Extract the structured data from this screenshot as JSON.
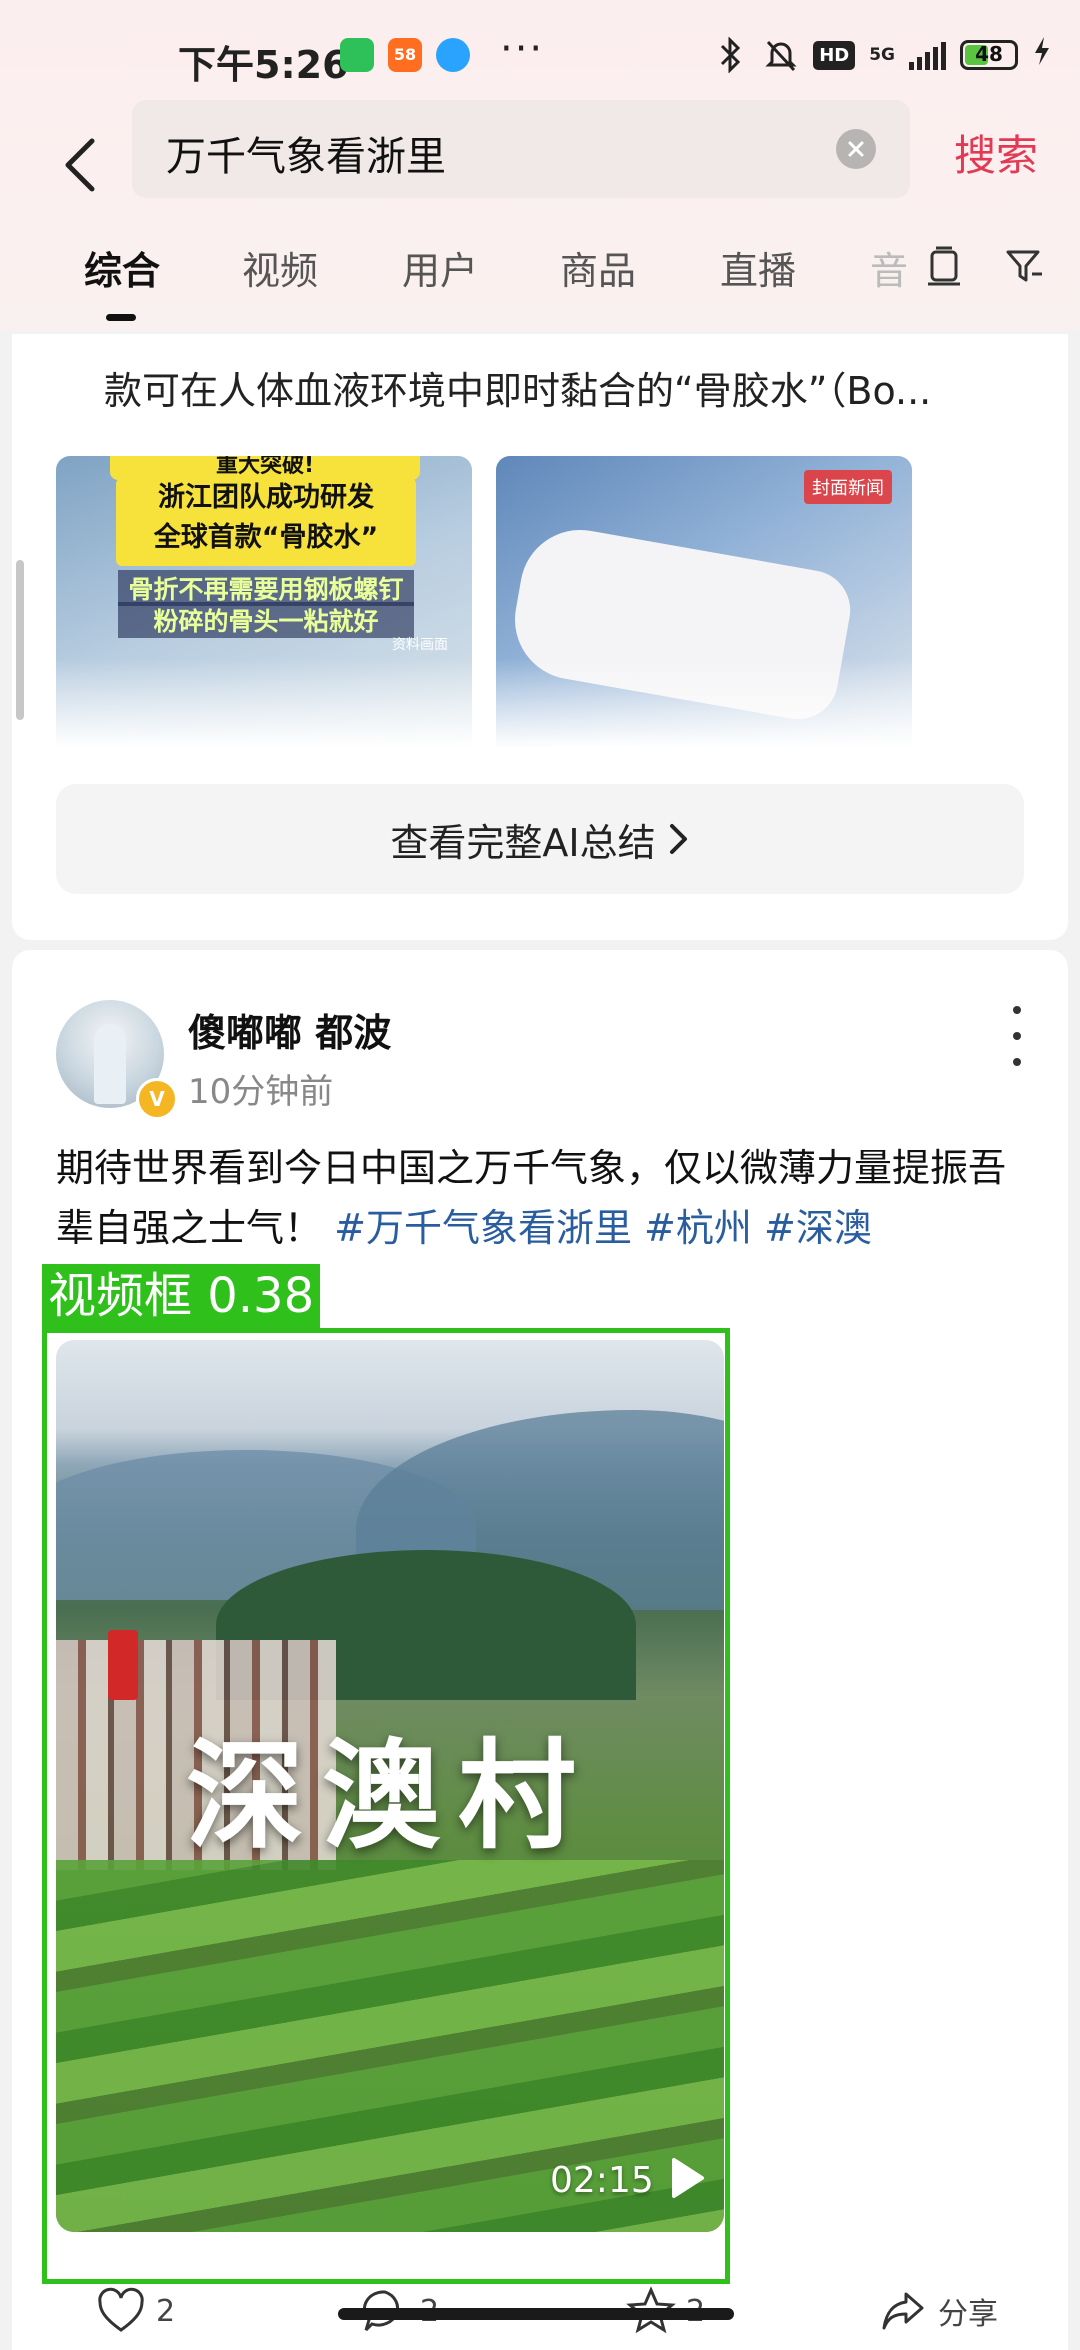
{
  "status_bar": {
    "time": "下午5:26",
    "app2_text": "58",
    "more": "···",
    "hd": "HD",
    "network": "5G",
    "battery": "48",
    "battery_level": 0.48
  },
  "header": {
    "search_query": "万千气象看浙里",
    "search_button": "搜索"
  },
  "tabs": {
    "items": [
      "综合",
      "视频",
      "用户",
      "商品",
      "直播"
    ],
    "partial": "音",
    "active_index": 0
  },
  "ai_summary": {
    "text": "款可在人体血液环境中即时黏合的“骨胶水”（Bo...",
    "thumb1": {
      "line0": "重大突破!",
      "line1": "浙江团队成功研发",
      "line2": "全球首款“骨胶水”",
      "line3": "骨折不再需要用钢板螺钉",
      "line4": "粉碎的骨头一粘就好",
      "small": "资料画面"
    },
    "thumb2": {
      "brand": "封面新闻"
    },
    "view_full_button": "查看完整AI总结"
  },
  "post": {
    "author": "傻嘟嘟 都波",
    "badge": "V",
    "time": "10分钟前",
    "text": "期待世界看到今日中国之万千气象，仅以微薄力量提振吾辈自强之士气！",
    "hashtags": [
      "#万千气象看浙里",
      "#杭州",
      "#深澳"
    ],
    "video": {
      "title": "深澳村",
      "duration": "02:15"
    }
  },
  "detection": {
    "label": "视频框 0.38"
  },
  "actions": {
    "like": "2",
    "comment": "2",
    "star": "2",
    "share": "分享"
  },
  "colors": {
    "accent": "#e23a54",
    "hashtag": "#2a5d9f",
    "detect": "#2fc01c"
  }
}
